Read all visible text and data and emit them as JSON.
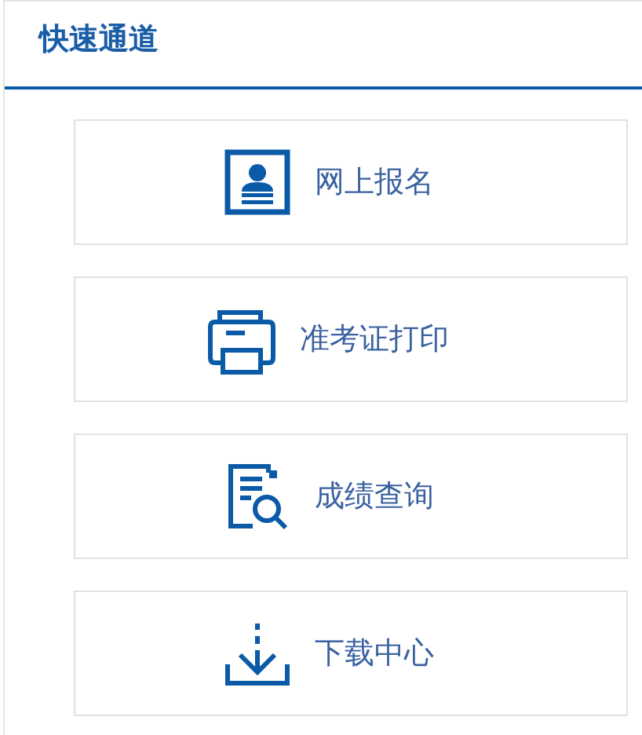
{
  "panel": {
    "title": "快速通道"
  },
  "links": [
    {
      "kind": "register",
      "label": "网上报名"
    },
    {
      "kind": "print",
      "label": "准考证打印"
    },
    {
      "kind": "query",
      "label": "成绩查询"
    },
    {
      "kind": "download",
      "label": "下载中心"
    }
  ]
}
